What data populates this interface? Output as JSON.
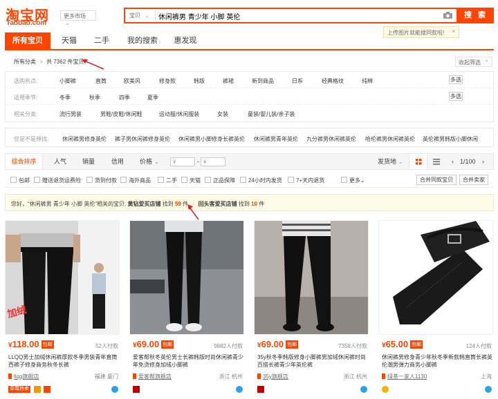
{
  "header": {
    "logo_cn": "淘宝网",
    "logo_en": "Taobao.com",
    "more_market": "更多市场",
    "search_category": "宝贝",
    "search_query": "休闲裤男 青少年 小脚 英伦",
    "search_button": "搜 索",
    "tooltip": "上传图片就能搜同款啦!",
    "tooltip_close": "×"
  },
  "tabs": [
    "所有宝贝",
    "天猫",
    "二手",
    "我的搜索",
    "惠发现"
  ],
  "breadcrumb": {
    "all": "所有分类",
    "sep": ">",
    "count_text": "共 7362 件宝贝"
  },
  "collapse_label": "收起筛选",
  "filters": [
    {
      "label": "选购热点:",
      "items": [
        "小脚裤",
        "直筒",
        "欧美风",
        "修身款",
        "韩版",
        "裤裙",
        "新到商品",
        "日系",
        "经典格纹",
        "纯棉"
      ],
      "multi": "多选"
    },
    {
      "label": "适用季节:",
      "items": [
        "冬季",
        "秋季",
        "四季",
        "夏季"
      ],
      "multi": "多选"
    },
    {
      "label": "相关分类:",
      "items": [
        "流行男装",
        "男鞋/皮鞋/休闲鞋",
        "运动服/休闲服装",
        "女装",
        "童装/婴儿装/亲子装"
      ],
      "multi": ""
    }
  ],
  "suggestions": {
    "label": "您是不是想找:",
    "items": [
      "休闲裤男修身英伦",
      "裤子男休闲裤修身英伦",
      "休闲裤男小脚修身长裤英伦",
      "休闲裤男青年英伦",
      "九分裤男休闲裤英伦",
      "哈伦裤男休闲裤英伦",
      "英伦裤男韩版小脚休闲"
    ]
  },
  "sortbar": {
    "sorts": [
      "综合排序",
      "人气",
      "销量",
      "信用",
      "价格"
    ],
    "price_from": "¥",
    "price_dash": "-",
    "price_to": "¥",
    "ship_from": "发货地",
    "page": "1/100"
  },
  "checks": [
    "包邮",
    "赠送退货运费险",
    "货到付款",
    "海外商品",
    "二手",
    "天猫",
    "正品保障",
    "24小时内发货",
    "7+天内退货"
  ],
  "more_label": "更多",
  "merge_buttons": [
    "合并同款宝贝",
    "合并卖家"
  ],
  "notice": {
    "prefix": "您好，“休闲裤男 青少年 小脚 英伦”相关的宝贝:",
    "part1_label": "黄钻爱买店铺",
    "part1_mid": "找到",
    "part1_count": "59",
    "part1_unit": "件",
    "sep": "|",
    "part2_label": "回头客爱买店铺",
    "part2_mid": "找到",
    "part2_count": "10",
    "part2_unit": "件"
  },
  "products": [
    {
      "currency": "¥",
      "price": "118.00",
      "badge": "包邮",
      "sold": "52人付款",
      "title": "LLQQ男士加绒休闲裤厚款冬季男装青年直筒西裤子修身商务秋冬长裤",
      "shop": "llqq旗舰店",
      "location": "福建 厦门",
      "tag": "草莓热卖"
    },
    {
      "currency": "¥",
      "price": "69.00",
      "badge": "包邮",
      "sold": "9882人付款",
      "title": "爱客帮秋冬英伦男士长裤韩版时尚休闲裤青少年免烫修身加绒小脚裤",
      "shop": "爱客帮旗舰店",
      "location": "浙江 杭州",
      "tag": ""
    },
    {
      "currency": "¥",
      "price": "69.00",
      "badge": "包邮",
      "sold": "7358人付款",
      "title": "35y秋冬季韩版修身小脚裤男加绒休闲裤时尚百搭长裤青少年英伦裤",
      "shop": "35y旗舰店",
      "location": "浙江 杭州",
      "tag": ""
    },
    {
      "currency": "¥",
      "price": "65.00",
      "badge": "包邮",
      "sold": "124人付款",
      "title": "休闲裤男修身青少年秋冬季新款韩直筒长裤英伦潮男弹力商务小脚裤",
      "shop": "绿茶一家人1130",
      "location": "上海",
      "tag": ""
    }
  ],
  "colors": {
    "accent": "#ff4400",
    "tooltip_bg": "#fffbe6"
  }
}
